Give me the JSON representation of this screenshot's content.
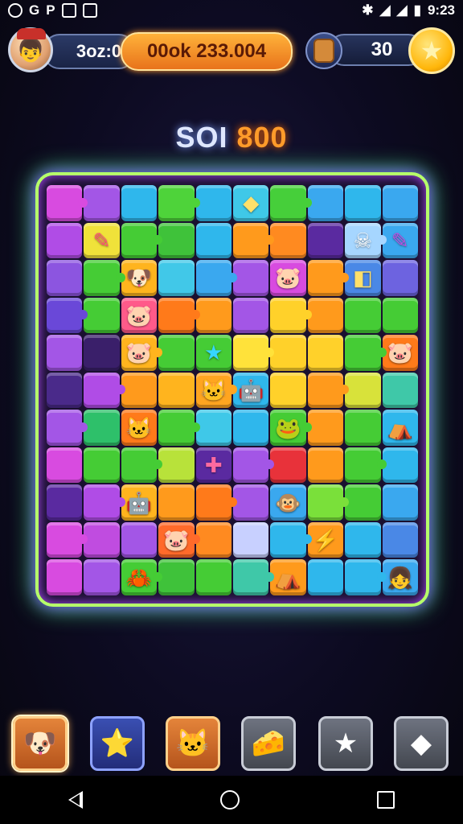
{
  "status_bar": {
    "left_icons": [
      "record-icon",
      "notification-icon",
      "image-icon",
      "backpack-icon"
    ],
    "left_text": "G",
    "p_text": "P",
    "time": "9:23"
  },
  "hud": {
    "level_text": "3oz:0",
    "coins_text": "00ok 233.004",
    "item_count": "30"
  },
  "score": {
    "label": "SOI",
    "value": "800"
  },
  "board": {
    "rows": 11,
    "cols": 10,
    "tiles": [
      [
        "#d84be0",
        "#a356e6",
        "#2fb7ec",
        "#4ed33a",
        "#2fb7ec",
        "#3fc8e8",
        "#46cf3a",
        "#3aa8ef",
        "#2fb7ec",
        "#3aa8ef"
      ],
      [
        "#b04ce6",
        "#f0e23a",
        "#45cc35",
        "#3fc23a",
        "#2fb7ec",
        "#ff9a1c",
        "#ff8a20",
        "#5a2aa0",
        "#a6d6ff",
        "#3aa8ef"
      ],
      [
        "#8c55e0",
        "#45cc35",
        "#ffb41e",
        "#41c8e8",
        "#3aa8ef",
        "#a356e6",
        "#d84be0",
        "#ff9a1c",
        "#4a88e6",
        "#6d63e0"
      ],
      [
        "#6a48d8",
        "#45cc35",
        "#ff5a8a",
        "#ff7a1a",
        "#ff9a1c",
        "#a356e6",
        "#ffd12a",
        "#ff9a1c",
        "#45cc35",
        "#45cc35"
      ],
      [
        "#a356e6",
        "#3a1f6a",
        "#ffb41e",
        "#45cc35",
        "#45cc35",
        "#ffe23a",
        "#ffd12a",
        "#ffd12a",
        "#45cc35",
        "#ff7a1a"
      ],
      [
        "#4a2a8a",
        "#b04ce6",
        "#ff9a1c",
        "#ffb41e",
        "#ffa520",
        "#2fb7ec",
        "#ffd12a",
        "#ff9a1c",
        "#d8e23a",
        "#3fc8a8"
      ],
      [
        "#a356e6",
        "#2ec06a",
        "#ff7a1a",
        "#45cc35",
        "#3fc8e8",
        "#2fb7ec",
        "#45cc35",
        "#ff9a1c",
        "#45cc35",
        "#2fb7ec"
      ],
      [
        "#d84be0",
        "#45cc35",
        "#45cc35",
        "#b8e23a",
        "#5a2aa0",
        "#a356e6",
        "#e8323a",
        "#ff9a1c",
        "#45cc35",
        "#2fb7ec"
      ],
      [
        "#5a2aa0",
        "#b04ce6",
        "#ffb41e",
        "#ff9a1c",
        "#ff7a1a",
        "#a356e6",
        "#3aa8ef",
        "#7ae03a",
        "#45cc35",
        "#3aa8ef"
      ],
      [
        "#d84be0",
        "#c04ce0",
        "#a356e6",
        "#ff6a2a",
        "#ff8a20",
        "#c8d0ff",
        "#2fb7ec",
        "#ff9a1c",
        "#2fb7ec",
        "#4a88e6"
      ],
      [
        "#d84be0",
        "#a356e6",
        "#45cc35",
        "#3fc23a",
        "#45cc35",
        "#3fc8a8",
        "#ff9a1c",
        "#2fb7ec",
        "#2fb7ec",
        "#3aa8ef"
      ]
    ],
    "pieces": [
      {
        "r": 0,
        "c": 5,
        "glyph": "◆",
        "color": "#ffe06a"
      },
      {
        "r": 1,
        "c": 1,
        "glyph": "✎",
        "color": "#ff4a7a"
      },
      {
        "r": 1,
        "c": 8,
        "glyph": "☠",
        "color": "#ffffff"
      },
      {
        "r": 1,
        "c": 9,
        "glyph": "✎",
        "color": "#c04ce0"
      },
      {
        "r": 2,
        "c": 2,
        "glyph": "🐶",
        "color": "#ffb41e"
      },
      {
        "r": 2,
        "c": 6,
        "glyph": "🐷",
        "color": "#e84a7a"
      },
      {
        "r": 2,
        "c": 8,
        "glyph": "◧",
        "color": "#ffe06a"
      },
      {
        "r": 3,
        "c": 2,
        "glyph": "🐷",
        "color": "#ff6aa0"
      },
      {
        "r": 4,
        "c": 2,
        "glyph": "🐷",
        "color": "#ff6a6a"
      },
      {
        "r": 4,
        "c": 4,
        "glyph": "★",
        "color": "#36d6ff"
      },
      {
        "r": 4,
        "c": 9,
        "glyph": "🐷",
        "color": "#ff5a2a"
      },
      {
        "r": 5,
        "c": 4,
        "glyph": "🐱",
        "color": "#ffb41e"
      },
      {
        "r": 5,
        "c": 5,
        "glyph": "🤖",
        "color": "#ffffff"
      },
      {
        "r": 6,
        "c": 2,
        "glyph": "🐱",
        "color": "#c04ce0"
      },
      {
        "r": 6,
        "c": 6,
        "glyph": "🐸",
        "color": "#3ad64a"
      },
      {
        "r": 6,
        "c": 9,
        "glyph": "⛺",
        "color": "#ffb41e"
      },
      {
        "r": 7,
        "c": 4,
        "glyph": "✚",
        "color": "#ff6aa0"
      },
      {
        "r": 8,
        "c": 2,
        "glyph": "🤖",
        "color": "#ffffff"
      },
      {
        "r": 8,
        "c": 6,
        "glyph": "🐵",
        "color": "#4aa8ff"
      },
      {
        "r": 9,
        "c": 3,
        "glyph": "🐷",
        "color": "#ff4a8a"
      },
      {
        "r": 9,
        "c": 7,
        "glyph": "⚡",
        "color": "#36d6ff"
      },
      {
        "r": 10,
        "c": 2,
        "glyph": "🦀",
        "color": "#ff7a1a"
      },
      {
        "r": 10,
        "c": 6,
        "glyph": "⛺",
        "color": "#ff6a2a"
      },
      {
        "r": 10,
        "c": 9,
        "glyph": "👧",
        "color": "#ffe0b8"
      }
    ]
  },
  "toolbar": [
    {
      "name": "dog-booster-icon",
      "glyph": "🐶",
      "style": "orange",
      "selected": true
    },
    {
      "name": "star-booster-icon",
      "glyph": "⭐",
      "style": "blue",
      "selected": false
    },
    {
      "name": "cat-booster-icon",
      "glyph": "🐱",
      "style": "orange",
      "selected": false
    },
    {
      "name": "cheese-booster-icon",
      "glyph": "🧀",
      "style": "gray",
      "selected": false
    },
    {
      "name": "silver-star-booster-icon",
      "glyph": "★",
      "style": "gray",
      "selected": false
    },
    {
      "name": "gem-booster-icon",
      "glyph": "◆",
      "style": "gray",
      "selected": false
    }
  ],
  "colors": {
    "board_border": "#b6ff6a",
    "coin_pill": "#ffb23a",
    "score_value": "#ff9b2a"
  }
}
